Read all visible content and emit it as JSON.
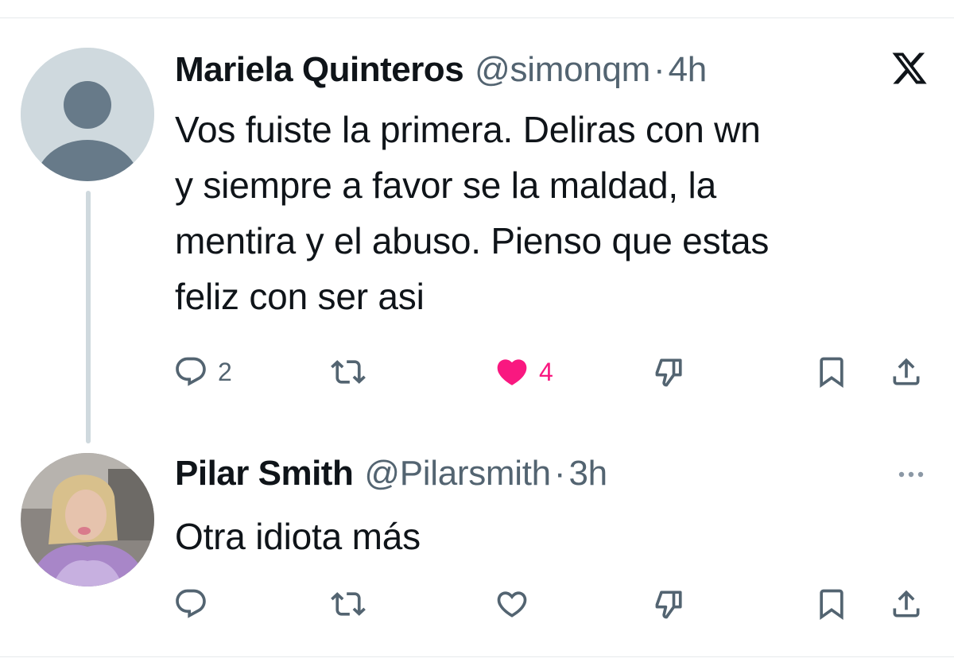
{
  "tweets": [
    {
      "name": "Mariela Quinteros",
      "handle": "@simonqm",
      "separator": "·",
      "time": "4h",
      "text_lines": [
        "Vos fuiste la primera. Deliras con wn",
        "y siempre a favor se la maldad, la",
        "mentira y el abuso. Pienso que estas",
        "feliz con ser asi"
      ],
      "header_icon": "x-logo-icon",
      "actions": {
        "reply_count": "2",
        "like_count": "4",
        "liked": true
      }
    },
    {
      "name": "Pilar Smith",
      "handle": "@Pilarsmith",
      "separator": "·",
      "time": "3h",
      "text_lines": [
        "Otra idiota más"
      ],
      "header_icon": "more-icon",
      "actions": {
        "reply_count": "",
        "like_count": "",
        "liked": false
      }
    }
  ],
  "colors": {
    "text": "#0f1419",
    "secondary": "#536471",
    "like": "#f91880",
    "thread_line": "#cfd9de",
    "avatar_placeholder": "#cfd9de",
    "avatar_silhouette": "#677a89"
  }
}
